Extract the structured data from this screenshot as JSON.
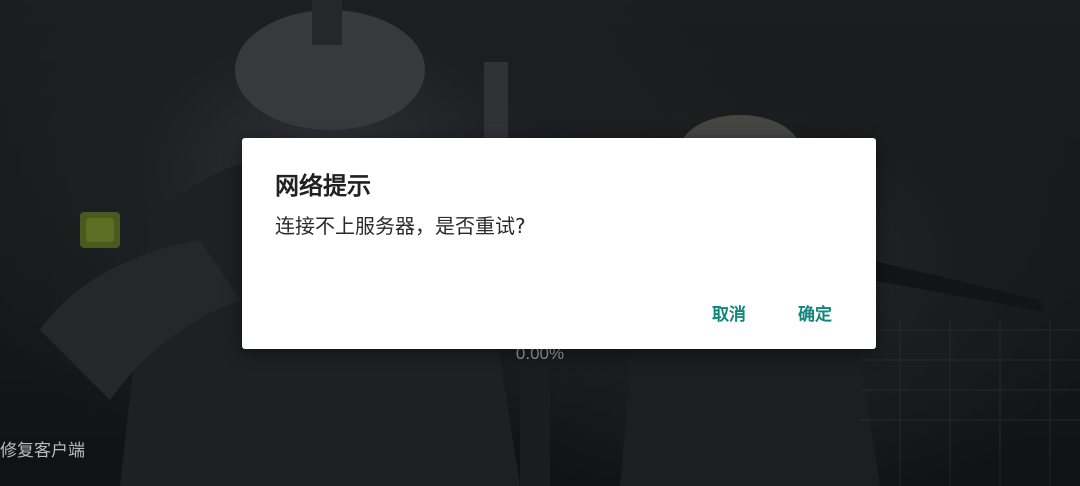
{
  "background": {
    "progress_text": "0.00%",
    "repair_link_label": "修复客户端"
  },
  "dialog": {
    "title": "网络提示",
    "message": "连接不上服务器，是否重试?",
    "cancel_label": "取消",
    "confirm_label": "确定",
    "accent_color": "#11867a"
  }
}
